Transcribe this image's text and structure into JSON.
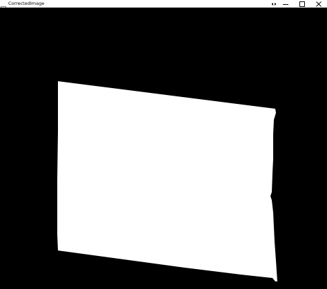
{
  "window": {
    "title": "CorrectedImage",
    "app_icon": "window-app-icon",
    "controls": [
      "expand-icon",
      "minimize-icon",
      "maximize-icon",
      "close-icon"
    ]
  },
  "image": {
    "background_color": "#000000",
    "shape_color": "#ffffff"
  }
}
